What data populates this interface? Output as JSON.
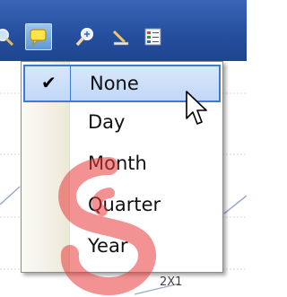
{
  "toolbar": {
    "buttons": [
      {
        "icon": "magnifier-partial-icon"
      },
      {
        "icon": "speech-bubble-icon",
        "active": true
      },
      {
        "icon": "zoom-icon"
      },
      {
        "icon": "pencil-ruler-icon"
      },
      {
        "icon": "chart-list-icon"
      }
    ]
  },
  "menu": {
    "items": [
      {
        "label": "None",
        "checked": true,
        "highlighted": true
      },
      {
        "label": "Day"
      },
      {
        "label": "Month"
      },
      {
        "label": "Quarter"
      },
      {
        "label": "Year"
      }
    ]
  },
  "chart": {
    "axis_label": "2X1"
  },
  "colors": {
    "toolbar": "#2a56a8",
    "highlight_border": "#3f79d4",
    "highlight_fill": "#c9ddf8",
    "watermark": "#e83a3a"
  }
}
